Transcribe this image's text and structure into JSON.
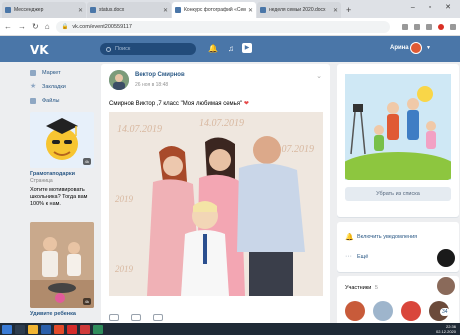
{
  "browser": {
    "tabs": [
      {
        "title": "Мессенджер",
        "active": false
      },
      {
        "title": "status.docx",
        "active": false
      },
      {
        "title": "Конкурс фотографий «Семья»",
        "active": true
      },
      {
        "title": "неделя семьи 2020.docx",
        "active": false
      }
    ],
    "new_tab": "+",
    "url": "vk.com/event200559117"
  },
  "vk_header": {
    "logo": "VK",
    "search_placeholder": "Поиск",
    "user_name": "Арина"
  },
  "left_nav": {
    "items": [
      {
        "label": "Маркет",
        "icon": "market-icon"
      },
      {
        "label": "Закладки",
        "icon": "star-icon"
      },
      {
        "label": "Файлы",
        "icon": "file-icon"
      }
    ]
  },
  "ads": [
    {
      "title": "Грамотаподарки",
      "subtitle": "Страница",
      "text": "Хотите мотивировать школьника? Тогда вам 100% к нам.",
      "badge": "4k"
    },
    {
      "title": "Удивите ребенка",
      "subtitle": "",
      "text": "",
      "badge": "4k"
    }
  ],
  "post": {
    "author": "Вектор Смирнов",
    "date": "26 ноя в 18:48",
    "text": "Смирнов Виктор ,7 класс \"Моя любимая семья\"",
    "heart": "❤",
    "photo_watermarks": [
      "14.07.2019",
      "14.07.2019",
      "14.07.2019",
      "2019",
      "2019",
      "2019"
    ]
  },
  "right_panel": {
    "remove_button": "Убрать из списка",
    "notifications_label": "Включить уведомления",
    "more_label": "Ещё",
    "members_title": "Участники",
    "members_count": "5",
    "chat_count": "34"
  },
  "taskbar": {
    "time": "22:36",
    "date": "02.12.2020"
  },
  "colors": {
    "vk_blue": "#4a76a8",
    "link": "#2a5885",
    "page_bg": "#edeef0"
  }
}
